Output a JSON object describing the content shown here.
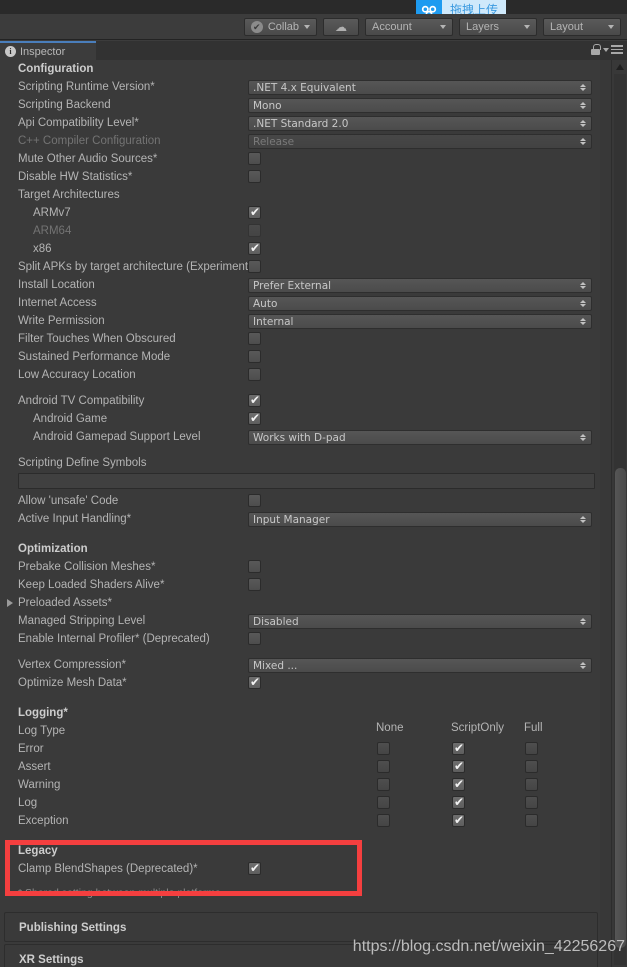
{
  "upload_widget": {
    "icon": "cloud-upload-icon",
    "label": "拖拽上传"
  },
  "toolbar": {
    "collab_label": "Collab",
    "cloud_icon": "cloud-icon",
    "account_label": "Account",
    "layers_label": "Layers",
    "layout_label": "Layout"
  },
  "tabbar": {
    "tab_label": "Inspector",
    "info_icon": "info-icon",
    "lock_icon": "lock-icon",
    "menu_icon": "hamburger-menu-icon"
  },
  "sections": {
    "configuration": "Configuration",
    "optimization": "Optimization",
    "logging": "Logging*",
    "legacy": "Legacy"
  },
  "config": {
    "scripting_runtime_version": {
      "label": "Scripting Runtime Version*",
      "value": ".NET 4.x Equivalent"
    },
    "scripting_backend": {
      "label": "Scripting Backend",
      "value": "Mono"
    },
    "api_compatibility_level": {
      "label": "Api Compatibility Level*",
      "value": ".NET Standard 2.0"
    },
    "cpp_compiler_configuration": {
      "label": "C++ Compiler Configuration",
      "value": "Release"
    },
    "mute_other_audio_sources": {
      "label": "Mute Other Audio Sources*",
      "value": false
    },
    "disable_hw_statistics": {
      "label": "Disable HW Statistics*",
      "value": false
    },
    "target_architectures": {
      "label": "Target Architectures"
    },
    "armv7": {
      "label": "ARMv7",
      "value": true
    },
    "arm64": {
      "label": "ARM64",
      "value": false
    },
    "x86": {
      "label": "x86",
      "value": true
    },
    "split_apks": {
      "label": "Split APKs by target architecture (Experimental)",
      "value": false
    },
    "install_location": {
      "label": "Install Location",
      "value": "Prefer External"
    },
    "internet_access": {
      "label": "Internet Access",
      "value": "Auto"
    },
    "write_permission": {
      "label": "Write Permission",
      "value": "Internal"
    },
    "filter_touches": {
      "label": "Filter Touches When Obscured",
      "value": false
    },
    "sustained_performance": {
      "label": "Sustained Performance Mode",
      "value": false
    },
    "low_accuracy_location": {
      "label": "Low Accuracy Location",
      "value": false
    },
    "android_tv_compat": {
      "label": "Android TV Compatibility",
      "value": true
    },
    "android_game": {
      "label": "Android Game",
      "value": true
    },
    "android_gamepad_support": {
      "label": "Android Gamepad Support Level",
      "value": "Works with D-pad"
    },
    "scripting_define_symbols": {
      "label": "Scripting Define Symbols",
      "value": "",
      "placeholder": ""
    },
    "allow_unsafe_code": {
      "label": "Allow 'unsafe' Code",
      "value": false
    },
    "active_input_handling": {
      "label": "Active Input Handling*",
      "value": "Input Manager"
    }
  },
  "optimization": {
    "prebake_collision_meshes": {
      "label": "Prebake Collision Meshes*",
      "value": false
    },
    "keep_loaded_shaders_alive": {
      "label": "Keep Loaded Shaders Alive*",
      "value": false
    },
    "preloaded_assets": {
      "label": "Preloaded Assets*"
    },
    "managed_stripping_level": {
      "label": "Managed Stripping Level",
      "value": "Disabled"
    },
    "enable_internal_profiler": {
      "label": "Enable Internal Profiler* (Deprecated)",
      "value": false
    },
    "vertex_compression": {
      "label": "Vertex Compression*",
      "value": "Mixed ..."
    },
    "optimize_mesh_data": {
      "label": "Optimize Mesh Data*",
      "value": true
    }
  },
  "logging": {
    "row_header": "Log Type",
    "columns": [
      "None",
      "ScriptOnly",
      "Full"
    ],
    "rows": [
      {
        "label": "Error",
        "none": false,
        "script_only": true,
        "full": false
      },
      {
        "label": "Assert",
        "none": false,
        "script_only": true,
        "full": false
      },
      {
        "label": "Warning",
        "none": false,
        "script_only": true,
        "full": false
      },
      {
        "label": "Log",
        "none": false,
        "script_only": true,
        "full": false
      },
      {
        "label": "Exception",
        "none": false,
        "script_only": true,
        "full": false
      }
    ]
  },
  "legacy": {
    "clamp_blendshapes": {
      "label": "Clamp BlendShapes (Deprecated)*",
      "value": true
    }
  },
  "footnote": "* Shared setting between multiple platforms.",
  "collapsed_sections": [
    {
      "label": "Publishing Settings"
    },
    {
      "label": "XR Settings"
    }
  ],
  "watermark": "https://blog.csdn.net/weixin_42256267",
  "colors": {
    "accent_blue": "#4a7ebb",
    "upload_blue": "#1e9bf0",
    "highlight_red": "#f43f3f",
    "panel_bg": "#3a3a3a"
  }
}
